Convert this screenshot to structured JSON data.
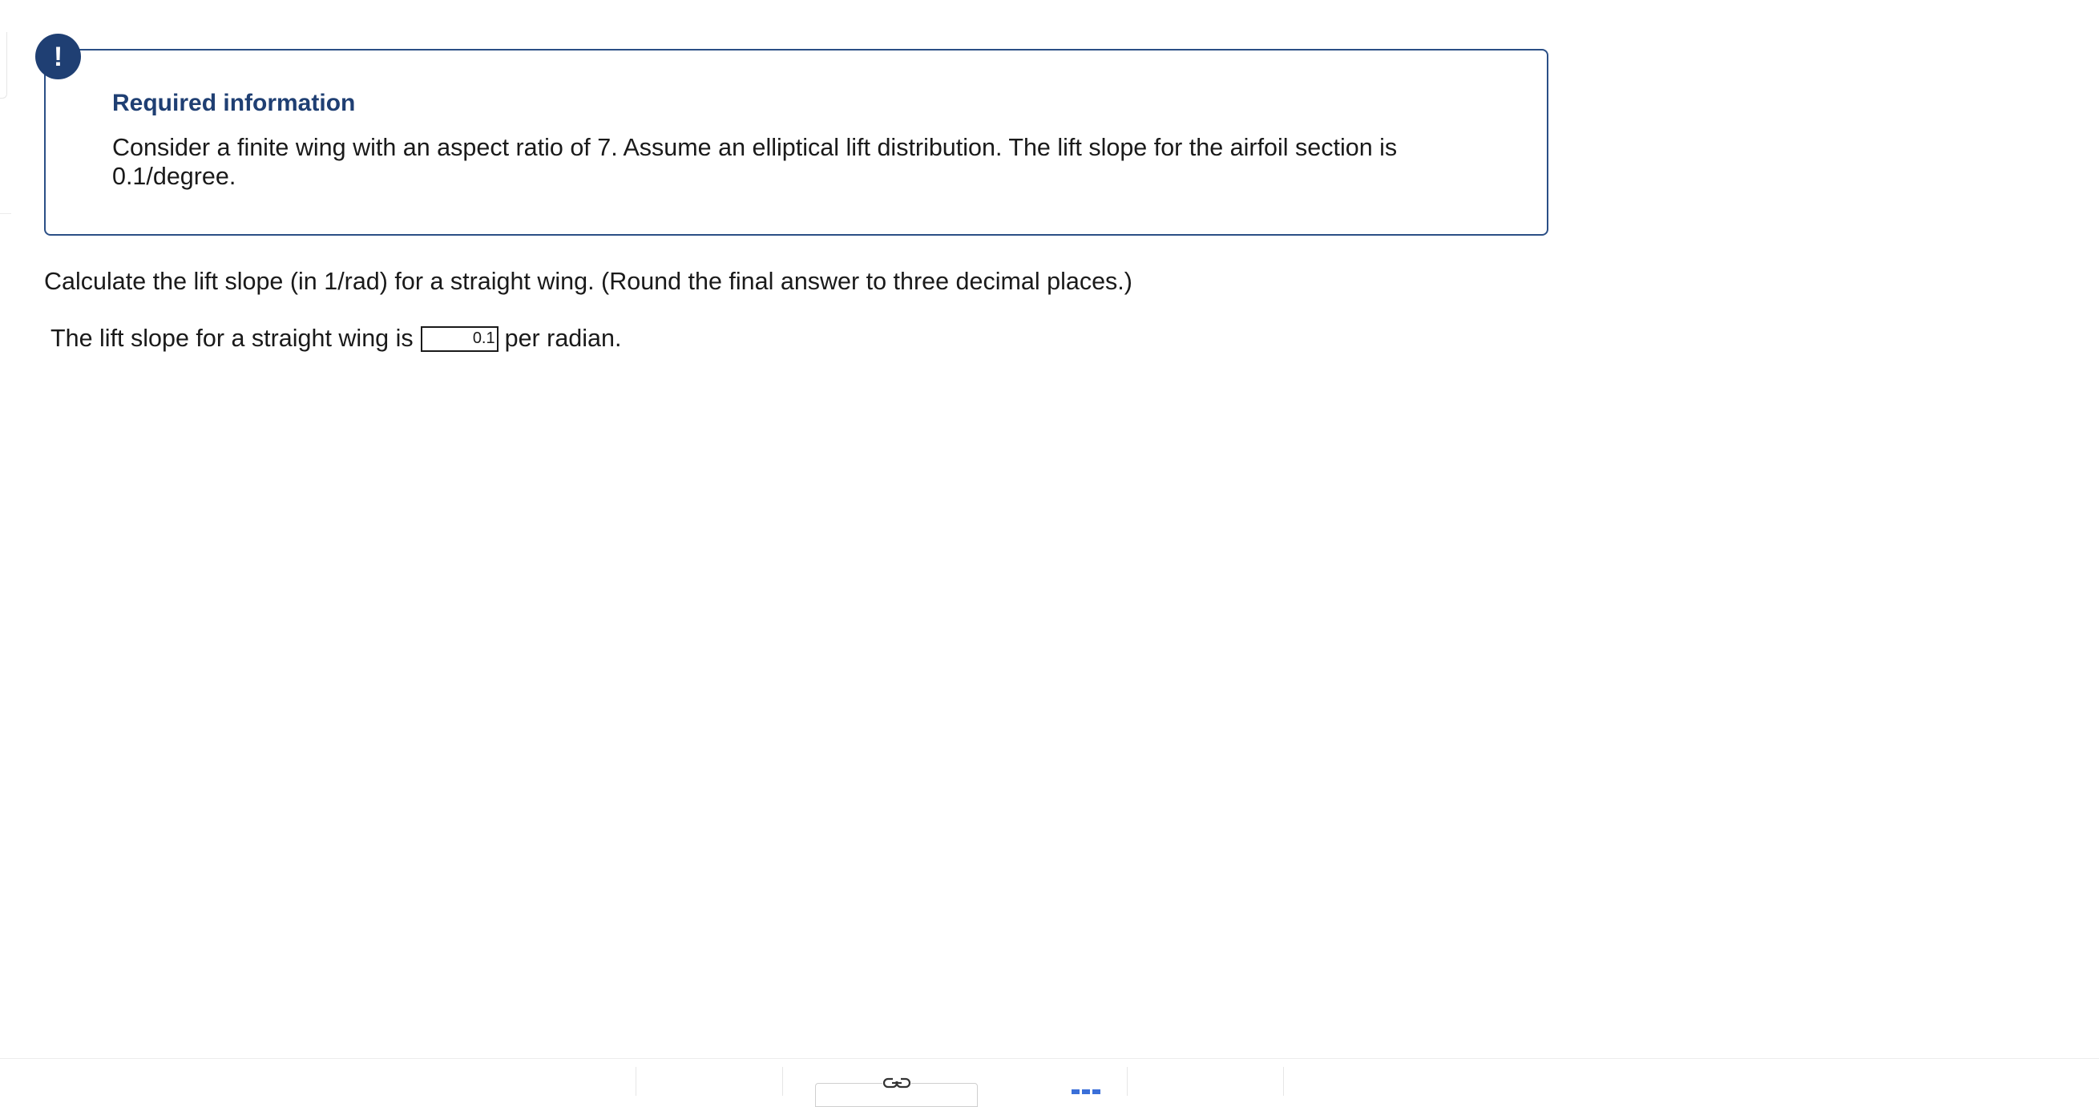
{
  "info": {
    "badge": "!",
    "title": "Required information",
    "body": "Consider a finite wing with an aspect ratio of 7. Assume an elliptical lift distribution. The lift slope for the airfoil section is 0.1/degree."
  },
  "question": {
    "prompt": "Calculate the lift slope (in 1/rad) for a straight wing. (Round the final answer to three decimal places.)",
    "answer_prefix": "The lift slope for a straight wing is",
    "answer_value": "0.1",
    "answer_suffix": "per radian."
  },
  "toolbar": {
    "icons": [
      "link-icon",
      "grid-icon"
    ]
  },
  "colors": {
    "accent": "#1f3f73",
    "border": "#2b4f86",
    "grid_icon": "#3a6fd8"
  }
}
